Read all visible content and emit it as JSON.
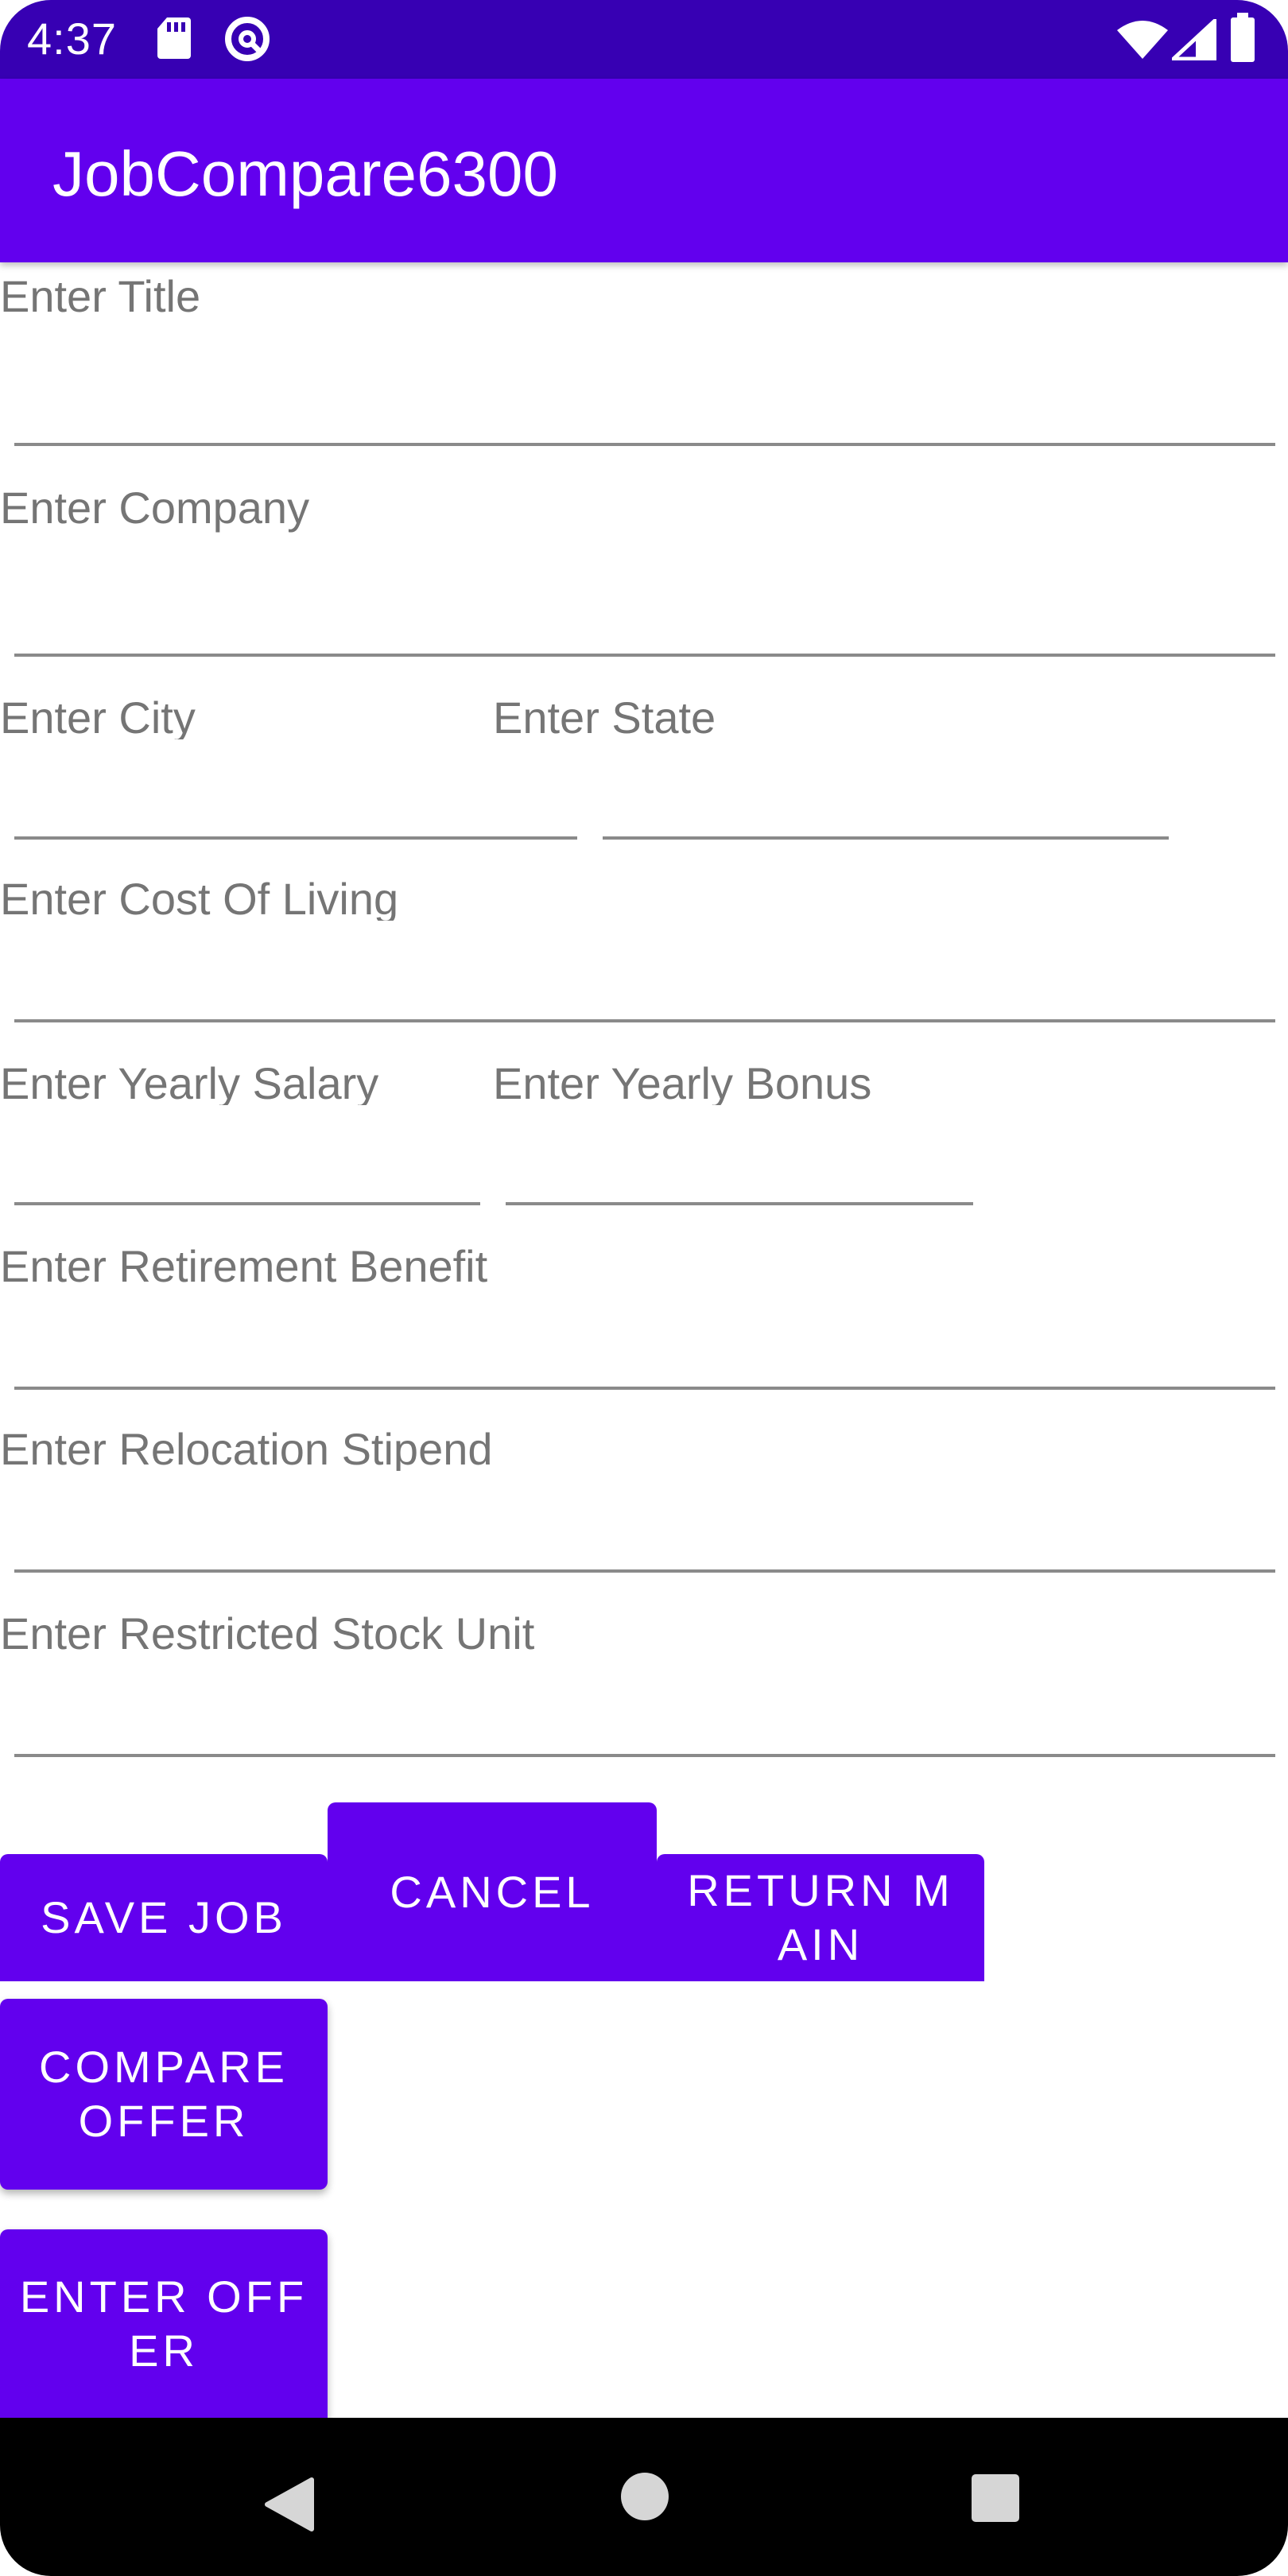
{
  "status_bar": {
    "time": "4:37",
    "left_icons": [
      "sd-card-icon",
      "do-not-disturb-icon"
    ],
    "right_icons": [
      "wifi-icon",
      "cell-signal-icon",
      "battery-icon"
    ]
  },
  "app_bar": {
    "title": "JobCompare6300"
  },
  "form": {
    "title_label": "Enter Title",
    "company_label": "Enter Company",
    "city_label": "Enter City",
    "state_label": "Enter State",
    "cost_of_living_label": "Enter Cost Of Living",
    "yearly_salary_label": "Enter Yearly Salary",
    "yearly_bonus_label": "Enter Yearly Bonus",
    "retirement_benefit_label": "Enter Retirement Benefit",
    "relocation_stipend_label": "Enter Relocation Stipend",
    "restricted_stock_label": "Enter Restricted Stock Unit"
  },
  "buttons": {
    "save_job": "SAVE JOB",
    "cancel": "CANCEL",
    "return_main": "RETURN MAIN",
    "compare_offer": "COMPARE OFFER",
    "enter_offer": "ENTER OFFER"
  },
  "nav_bar": {
    "icons": [
      "back-icon",
      "home-icon",
      "recents-icon"
    ]
  },
  "colors": {
    "status_bar": "#3700b3",
    "primary": "#6200ee",
    "label": "#757575",
    "underline": "#8a8a8a",
    "nav_bar": "#000000"
  }
}
